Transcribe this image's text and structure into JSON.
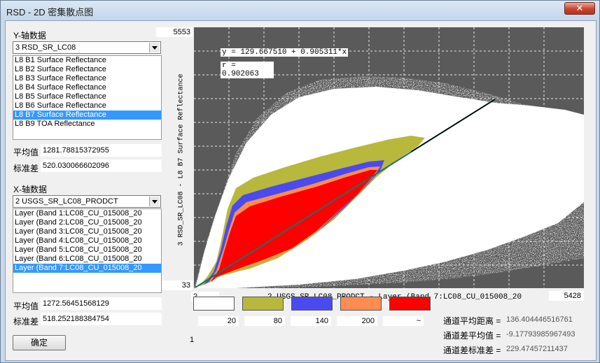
{
  "window": {
    "title": "RSD - 2D 密集散点图",
    "close_glyph": "✕"
  },
  "y_axis": {
    "label": "Y-轴数据",
    "selected": "3  RSD_SR_LC08",
    "items": [
      "L8 B1 Surface Reflectance",
      "L8 B2 Surface Reflectance",
      "L8 B3 Surface Reflectance",
      "L8 B4 Surface Reflectance",
      "L8 B5 Surface Reflectance",
      "L8 B6 Surface Reflectance",
      "L8 B7 Surface Reflectance",
      "L8 B9 TOA Reflectance"
    ],
    "selected_index": 6,
    "mean_label": "平均值",
    "mean_value": "1281.78815372955",
    "std_label": "标准差",
    "std_value": "520.030066602096"
  },
  "x_axis": {
    "label": "X-轴数据",
    "selected": "2  USGS_SR_LC08_PRODCT",
    "items": [
      "Layer (Band 1:LC08_CU_015008_20",
      "Layer (Band 2:LC08_CU_015008_20",
      "Layer (Band 3:LC08_CU_015008_20",
      "Layer (Band 4:LC08_CU_015008_20",
      "Layer (Band 5:LC08_CU_015008_20",
      "Layer (Band 6:LC08_CU_015008_20",
      "Layer (Band 7:LC08_CU_015008_20"
    ],
    "selected_index": 6,
    "mean_label": "平均值",
    "mean_value": "1272.56451568129",
    "std_label": "标准差",
    "std_value": "518.252188384754"
  },
  "ok_button": "确定",
  "plot": {
    "y_max": "5553",
    "y_min": "33",
    "x_min": "2",
    "x_max": "5428",
    "x_title": "2   USGS_SR_LC08_PRODCT - Layer (Band 7:LC08_CU_015008_20",
    "y_title": "3   RSD_SR_LC08 - L8 B7 Surface Reflectance",
    "equation": "y = 129.667510 + 0.905311*x",
    "r_value": "r = 0.902063",
    "colors": {
      "background": "#5a5a5a",
      "white": "#ffffff",
      "olive": "#b8b83c",
      "blue": "#4a4af0",
      "orange": "#ff8c50",
      "red": "#ff0000",
      "line": "#1f6f6a"
    }
  },
  "legend": {
    "colors": [
      "#ffffff",
      "#b8b83c",
      "#4a4af0",
      "#ff8c50",
      "#ff0000"
    ],
    "start": "1",
    "breaks": [
      "20",
      "80",
      "140",
      "200",
      "~"
    ]
  },
  "stats": [
    {
      "label": "通道平均距离 =",
      "value": "136.404446516761"
    },
    {
      "label": "通道差平均值 =",
      "value": "-9.17793985967493"
    },
    {
      "label": "通道差标准差 =",
      "value": "229.47457211437"
    }
  ]
}
